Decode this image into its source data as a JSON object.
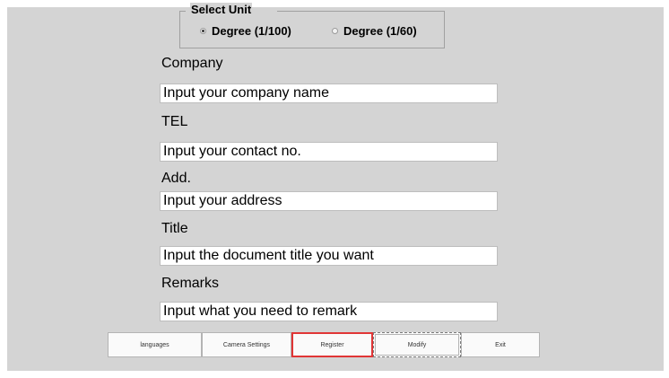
{
  "unit_selector": {
    "legend": "Select Unit",
    "options": [
      {
        "label": "Degree (1/100)",
        "checked": true
      },
      {
        "label": "Degree (1/60)",
        "checked": false
      }
    ]
  },
  "form": {
    "company": {
      "label": "Company",
      "placeholder": "Input your company name"
    },
    "tel": {
      "label": "TEL",
      "placeholder": "Input your contact no."
    },
    "address": {
      "label": "Add.",
      "placeholder": "Input your address"
    },
    "title": {
      "label": "Title",
      "placeholder": "Input the document title you want"
    },
    "remarks": {
      "label": "Remarks",
      "placeholder": "Input what you need to remark"
    }
  },
  "buttons": {
    "languages": "languages",
    "camera_settings": "Camera Settings",
    "register": "Register",
    "modify": "Modify",
    "exit": "Exit"
  },
  "colors": {
    "panel_bg": "#d4d4d4",
    "focus_border": "#e03535"
  }
}
